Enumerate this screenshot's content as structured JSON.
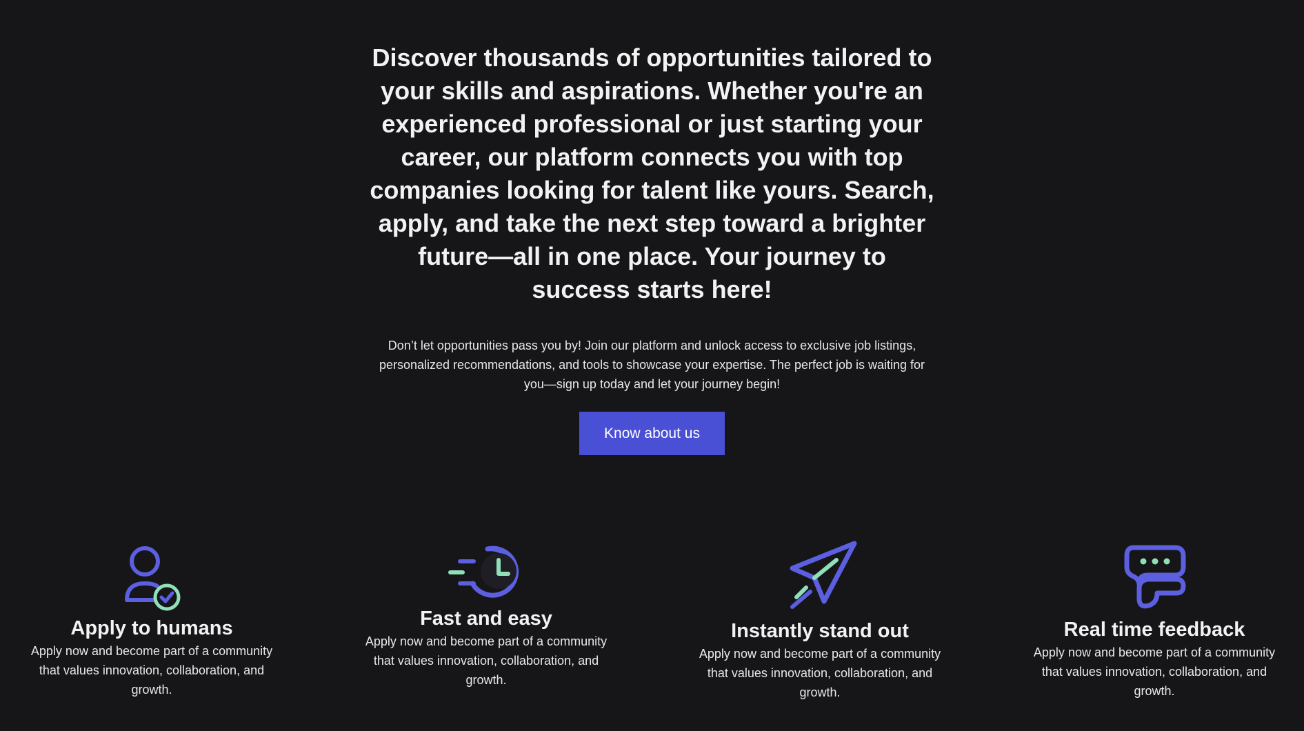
{
  "hero": {
    "headline": "Discover thousands of opportunities tailored to your skills and aspirations. Whether you're an experienced professional or just starting your career, our platform connects you with top companies looking for talent like yours. Search, apply, and take the next step toward a brighter future—all in one place. Your journey to success starts here!",
    "subtext": "Don’t let opportunities pass you by! Join our platform and unlock access to exclusive job listings, personalized recommendations, and tools to showcase your expertise. The perfect job is waiting for you—sign up today and let your journey begin!",
    "cta_label": "Know about us"
  },
  "colors": {
    "background": "#161618",
    "accent": "#4a50d6",
    "icon_primary": "#5b5fe0",
    "icon_secondary": "#8fe0b8"
  },
  "features": [
    {
      "icon": "user-check-icon",
      "title": "Apply to humans",
      "description": "Apply now and become part of a community that values innovation, collaboration, and growth."
    },
    {
      "icon": "fast-clock-icon",
      "title": "Fast and easy",
      "description": "Apply now and become part of a community that values innovation, collaboration, and growth."
    },
    {
      "icon": "paper-plane-icon",
      "title": "Instantly stand out",
      "description": "Apply now and become part of a community that values innovation, collaboration, and growth."
    },
    {
      "icon": "chat-bubbles-icon",
      "title": "Real time feedback",
      "description": "Apply now and become part of a community that values innovation, collaboration, and growth."
    }
  ]
}
